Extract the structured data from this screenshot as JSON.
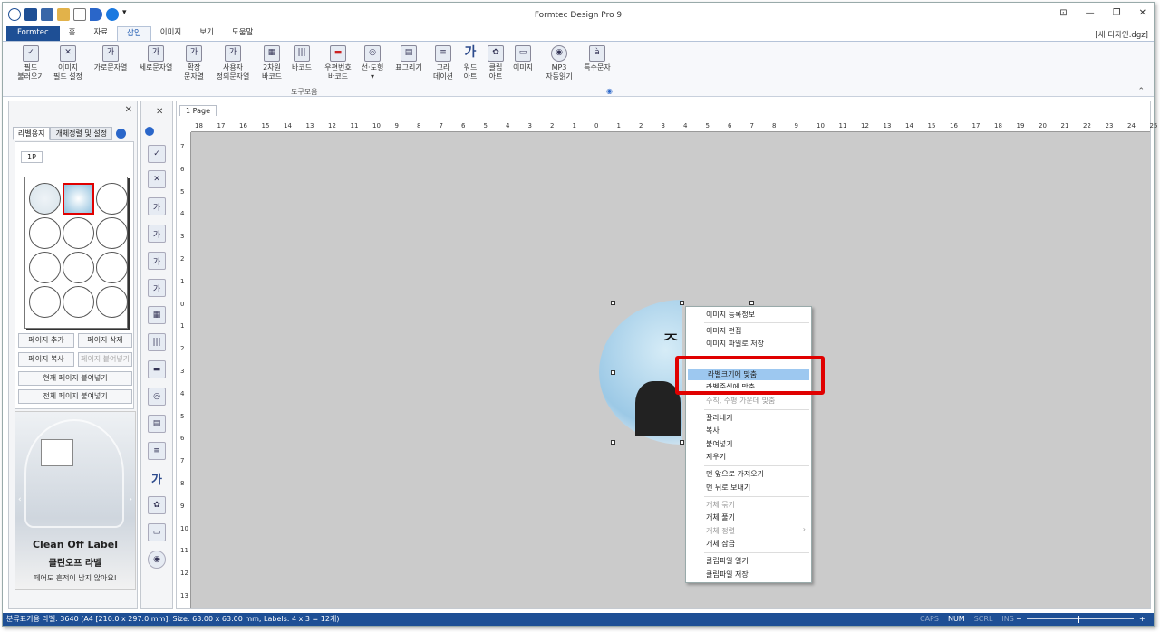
{
  "window": {
    "title": "Formtec Design Pro 9",
    "filename": "[새 디자인.dgz]"
  },
  "tabs": [
    {
      "label": "Formtec"
    },
    {
      "label": "홈"
    },
    {
      "label": "자료"
    },
    {
      "label": "삽입"
    },
    {
      "label": "이미지"
    },
    {
      "label": "보기"
    },
    {
      "label": "도움말"
    }
  ],
  "ribbon": {
    "items": [
      {
        "line1": "필드",
        "line2": "불러오기",
        "icon": "field-load-icon"
      },
      {
        "line1": "이미지",
        "line2": "필드 설정",
        "icon": "image-field-icon"
      },
      {
        "line1": "가로문자열",
        "line2": "",
        "icon": "horizontal-text-icon"
      },
      {
        "line1": "세로문자열",
        "line2": "",
        "icon": "vertical-text-icon"
      },
      {
        "line1": "확장",
        "line2": "문자열",
        "icon": "extended-text-icon"
      },
      {
        "line1": "사용자",
        "line2": "정의문자열",
        "icon": "custom-text-icon"
      },
      {
        "line1": "2차원",
        "line2": "바코드",
        "icon": "qr-code-icon"
      },
      {
        "line1": "바코드",
        "line2": "",
        "icon": "barcode-icon"
      },
      {
        "line1": "우편번호",
        "line2": "바코드",
        "icon": "postal-barcode-icon"
      },
      {
        "line1": "선·도형",
        "line2": "▾",
        "icon": "shape-icon"
      },
      {
        "line1": "표그리기",
        "line2": "",
        "icon": "table-icon"
      },
      {
        "line1": "그라",
        "line2": "데이션",
        "icon": "gradation-icon"
      },
      {
        "line1": "워드",
        "line2": "아트",
        "icon": "word-art-icon"
      },
      {
        "line1": "클립",
        "line2": "아트",
        "icon": "clip-art-icon"
      },
      {
        "line1": "이미지",
        "line2": "",
        "icon": "image-icon"
      },
      {
        "line1": "MP3",
        "line2": "자동읽기",
        "icon": "mp3-icon"
      },
      {
        "line1": "특수문자",
        "line2": "",
        "icon": "special-char-icon"
      }
    ],
    "group_label": "도구모음"
  },
  "left_panel": {
    "tabs": [
      {
        "label": "라벨용지"
      },
      {
        "label": "개체정렬 및 설정"
      }
    ],
    "page_tab": "1P",
    "buttons": {
      "add_page": "페이지 추가",
      "delete_page": "페이지 삭제",
      "copy_page": "페이지 복사",
      "paste_page": "페이지 붙여넣기",
      "paste_current": "현재 페이지 붙여넣기",
      "paste_all": "전체 페이지 붙여넣기"
    },
    "ad": {
      "title": "Clean Off Label",
      "subtitle": "클린오프 라벨",
      "caption": "떼어도 흔적이 남지 않아요!"
    }
  },
  "document": {
    "tab": "1 Page",
    "hruler": [
      "18",
      "17",
      "16",
      "15",
      "14",
      "13",
      "12",
      "11",
      "10",
      "9",
      "8",
      "7",
      "6",
      "5",
      "4",
      "3",
      "2",
      "1",
      "0",
      "1",
      "2",
      "3",
      "4",
      "5",
      "6",
      "7",
      "8",
      "9",
      "10",
      "11",
      "12",
      "13",
      "14",
      "15",
      "16",
      "17",
      "18",
      "19",
      "20",
      "21",
      "22",
      "23",
      "24",
      "25"
    ],
    "vruler": [
      "7",
      "6",
      "5",
      "4",
      "3",
      "2",
      "1",
      "0",
      "1",
      "2",
      "3",
      "4",
      "5",
      "6",
      "7",
      "8",
      "9",
      "10",
      "11",
      "12",
      "13"
    ]
  },
  "context_menu": {
    "items": [
      {
        "label": "이미지 등록정보",
        "state": "normal"
      },
      {
        "label": "이미지 편집",
        "state": "normal"
      },
      {
        "label": "이미지 파일로 저장",
        "state": "normal"
      },
      {
        "label": "라벨크기에 맞춤",
        "state": "selected"
      },
      {
        "label": "라벨중심에 맞춤",
        "state": "normal"
      },
      {
        "label": "수직, 수평 가운데 맞춤",
        "state": "disabled"
      },
      {
        "label": "잘라내기",
        "state": "normal"
      },
      {
        "label": "복사",
        "state": "normal"
      },
      {
        "label": "붙여넣기",
        "state": "normal"
      },
      {
        "label": "지우기",
        "state": "normal"
      },
      {
        "label": "맨 앞으로 가져오기",
        "state": "normal"
      },
      {
        "label": "맨 뒤로 보내기",
        "state": "normal"
      },
      {
        "label": "개체 묶기",
        "state": "disabled"
      },
      {
        "label": "개체 풀기",
        "state": "normal"
      },
      {
        "label": "개체 정렬",
        "state": "disabled"
      },
      {
        "label": "개체 잠금",
        "state": "normal"
      },
      {
        "label": "클립파일 열기",
        "state": "normal"
      },
      {
        "label": "클립파일 저장",
        "state": "normal"
      }
    ]
  },
  "status": {
    "info": "분류표기용 라벨: 3640 (A4 [210.0 x 297.0 mm], Size: 63.00 x 63.00 mm,  Labels: 4 x 3 = 12개)",
    "caps": "CAPS",
    "num": "NUM",
    "scrl": "SCRL",
    "ins": "INS",
    "zoom_minus": "−",
    "zoom_plus": "+"
  },
  "colors": {
    "accent": "#1e4f95",
    "highlight": "#e00000",
    "menu_selected": "#9dc8f0"
  }
}
